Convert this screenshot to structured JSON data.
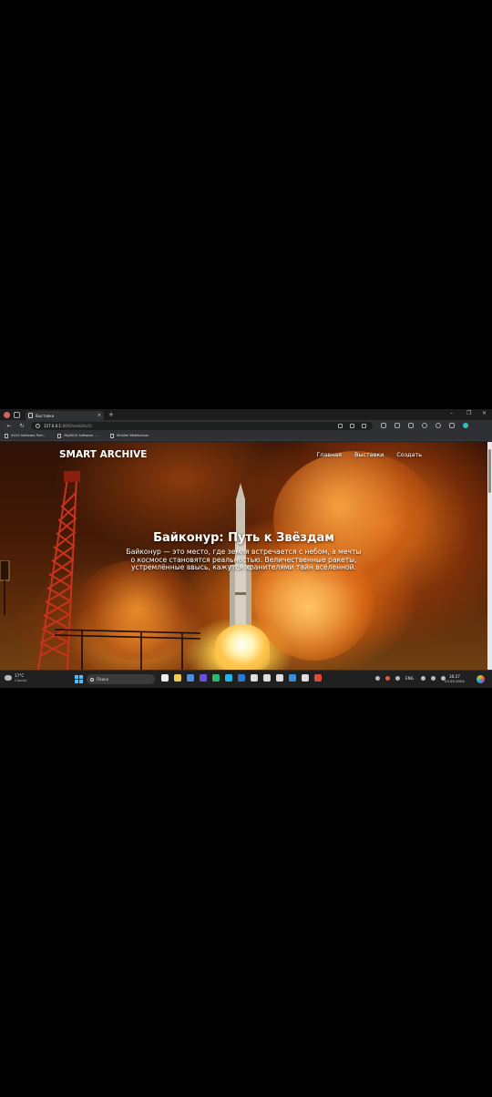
{
  "browser": {
    "tab_title": "Выставки",
    "tab_close": "×",
    "new_tab": "+",
    "url_host": "127.0.0.1",
    "url_path": ":8000/exhibits/3/",
    "window_controls": [
      "–",
      "❐",
      "×"
    ],
    "bookmarks": [
      {
        "label": "ASUS Software Port..."
      },
      {
        "label": "MyASUS Software -..."
      },
      {
        "label": "McAfee WebAdvisor"
      }
    ]
  },
  "site": {
    "brand": "SMART ARCHIVE",
    "nav": [
      {
        "label": "Главная"
      },
      {
        "label": "Выставки"
      },
      {
        "label": "Создать"
      }
    ]
  },
  "hero": {
    "title": "Байконур: Путь к Звёздам",
    "text": "Байконур — это место, где земля встречается с небом, а мечты о космосе становятся реальностью. Величественные ракеты, устремлённые ввысь, кажутся хранителями тайн вселенной."
  },
  "taskbar": {
    "weather_temp": "17°C",
    "weather_cond": "Cloudy",
    "search_label": "Поиск",
    "lang": "ENG",
    "time": "16:27",
    "date": "23.05.2024"
  },
  "colors": {
    "chrome_bg": "#202124",
    "accent": "#4cc2ff"
  },
  "icons": {
    "browser": [
      "profile-avatar-icon",
      "workspaces-icon",
      "back-icon",
      "forward-icon",
      "refresh-icon",
      "site-info-icon",
      "read-aloud-icon",
      "favorite-star-icon",
      "split-screen-icon",
      "favorites-icon",
      "collections-icon",
      "extensions-icon",
      "copilot-icon"
    ],
    "taskbar": [
      "windows-start-icon",
      "search-icon",
      "file-explorer-icon",
      "edge-icon",
      "vscode-icon",
      "store-icon"
    ]
  }
}
